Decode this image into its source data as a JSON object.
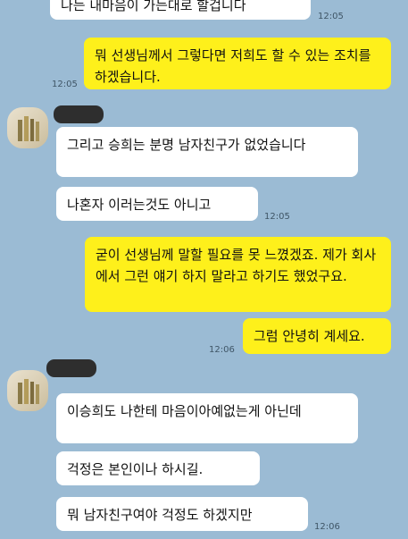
{
  "messages": [
    {
      "text": "나는 내마음이 가는대로 할겁니다",
      "time": "12:05"
    },
    {
      "text": "뭐 선생님께서 그렇다면 저희도 할 수 있는 조치를 하겠습니다.",
      "time": "12:05"
    },
    {
      "text": "그리고 승희는 분명 남자친구가 없었습니다"
    },
    {
      "text": "나혼자 이러는것도 아니고",
      "time": "12:05"
    },
    {
      "text": "굳이 선생님께 말할 필요를 못 느꼈겠죠. 제가 회사에서 그런 얘기 하지 말라고 하기도 했었구요."
    },
    {
      "text": "그럼 안녕히 계세요.",
      "time": "12:06"
    },
    {
      "text": "이승희도 나한테 마음이아예없는게 아닌데"
    },
    {
      "text": "걱정은 본인이나 하시길."
    },
    {
      "text": "뭐 남자친구여야 걱정도 하겠지만",
      "time": "12:06"
    }
  ]
}
